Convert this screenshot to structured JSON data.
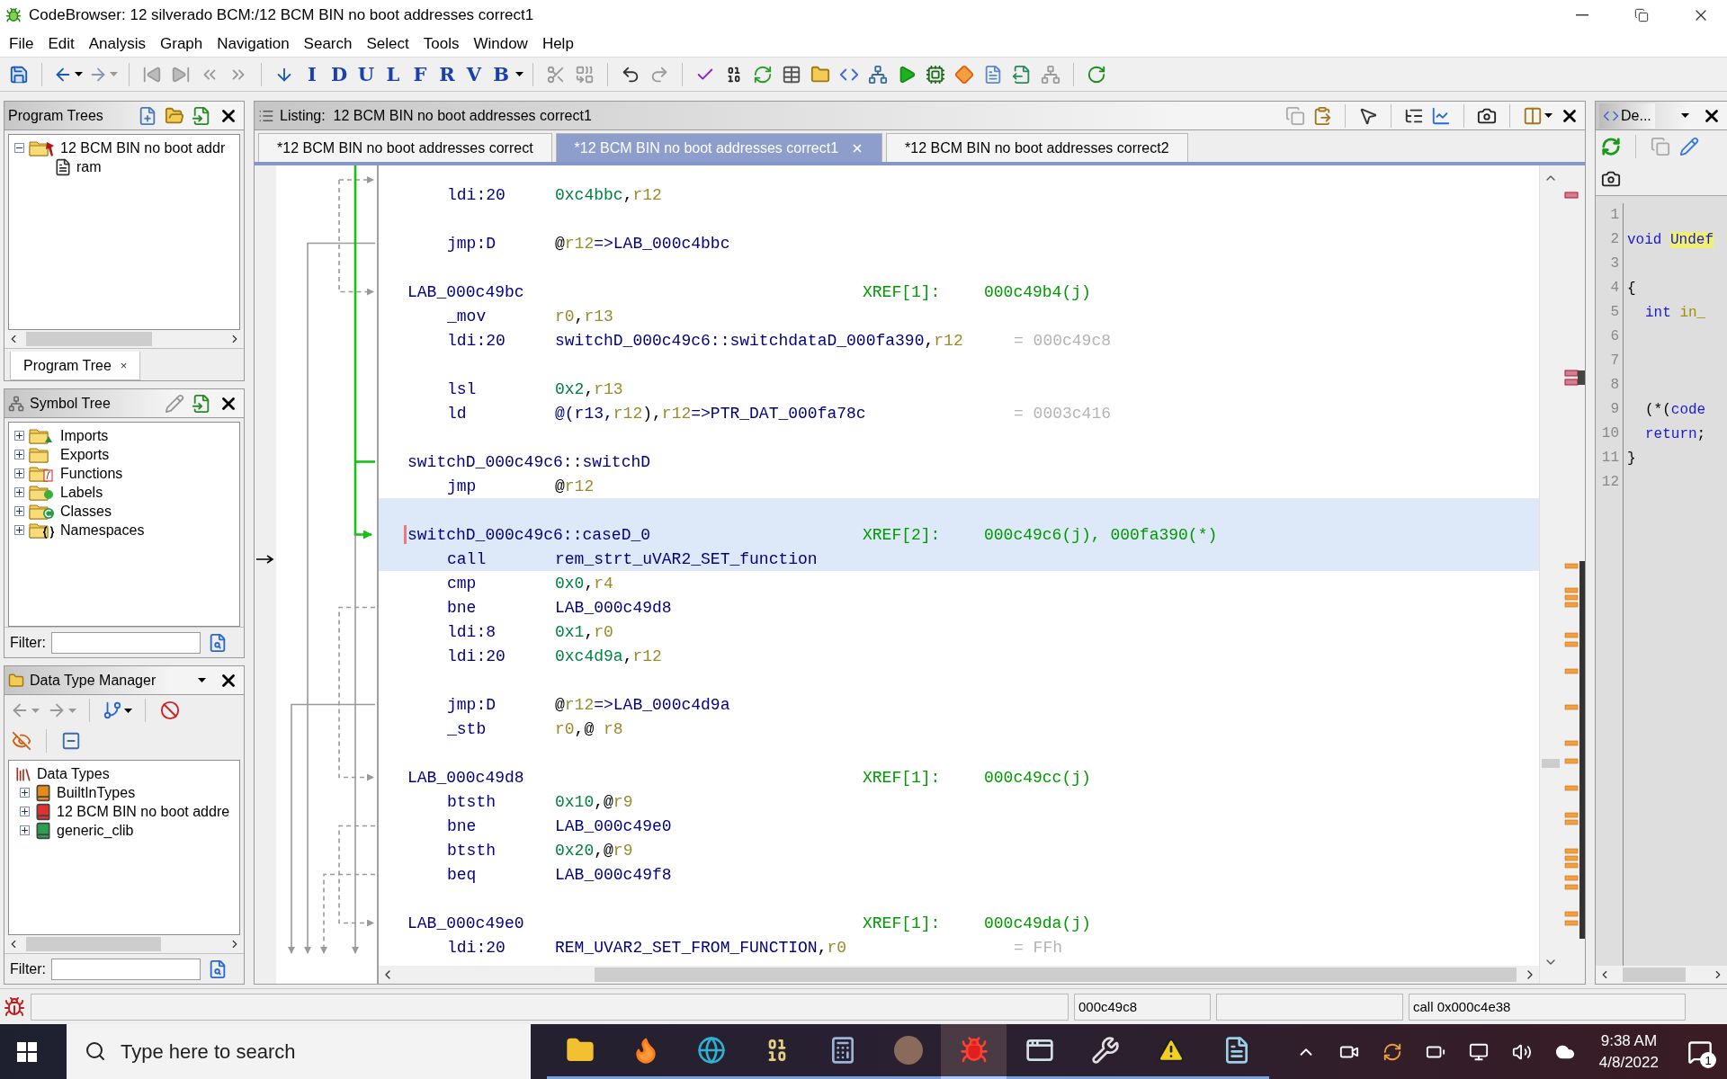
{
  "window": {
    "title": "CodeBrowser: 12 silverado BCM:/12 BCM BIN no boot addresses correct1"
  },
  "menu": [
    "File",
    "Edit",
    "Analysis",
    "Graph",
    "Navigation",
    "Search",
    "Select",
    "Tools",
    "Window",
    "Help"
  ],
  "toolbar": {
    "letter_buttons": [
      "I",
      "D",
      "U",
      "L",
      "F",
      "R",
      "V",
      "B"
    ]
  },
  "program_trees": {
    "title": "Program Trees",
    "tree": [
      {
        "label": "12 BCM BIN no boot addr",
        "expanded": true,
        "children": [
          {
            "label": "ram"
          }
        ]
      }
    ],
    "bottom_tab": {
      "label": "Program Tree",
      "close": "×"
    }
  },
  "symbol_tree": {
    "title": "Symbol Tree",
    "items": [
      {
        "label": "Imports",
        "kind": "imports",
        "expanded": false
      },
      {
        "label": "Exports",
        "kind": "exports",
        "expanded": false
      },
      {
        "label": "Functions",
        "kind": "functions",
        "expanded": false
      },
      {
        "label": "Labels",
        "kind": "labels",
        "expanded": false
      },
      {
        "label": "Classes",
        "kind": "classes",
        "expanded": false
      },
      {
        "label": "Namespaces",
        "kind": "namespaces",
        "expanded": false
      }
    ],
    "filter_label": "Filter:"
  },
  "data_type_manager": {
    "title": "Data Type Manager",
    "root": {
      "label": "Data Types",
      "children": [
        {
          "label": "BuiltInTypes",
          "kind": "builtin",
          "expanded": false
        },
        {
          "label": "12 BCM BIN no boot addre",
          "kind": "program",
          "expanded": false
        },
        {
          "label": "generic_clib",
          "kind": "archive",
          "expanded": false
        }
      ]
    },
    "filter_label": "Filter:"
  },
  "listing": {
    "title": "Listing:  12 BCM BIN no boot addresses correct1",
    "tabs": [
      {
        "label": "*12 BCM BIN no boot addresses correct",
        "selected": false
      },
      {
        "label": "*12 BCM BIN no boot addresses correct1",
        "selected": true
      },
      {
        "label": "*12 BCM BIN no boot addresses correct2",
        "selected": false
      }
    ],
    "rows": [
      {
        "kind": "instr",
        "mnemonic": "ldi:20",
        "operands": [
          {
            "text": "0xc4bbc",
            "kind": "num"
          },
          {
            "text": ",",
            "kind": "punct"
          },
          {
            "text": "r12",
            "kind": "reg"
          }
        ],
        "selected": false,
        "cursor": false,
        "current": false
      },
      {
        "kind": "blank",
        "selected": false,
        "cursor": false,
        "current": false
      },
      {
        "kind": "instr",
        "mnemonic": "jmp:D",
        "operands": [
          {
            "text": "@",
            "kind": "punct"
          },
          {
            "text": "r12",
            "kind": "reg"
          },
          {
            "text": "=>LAB_000c4bbc",
            "kind": "sym"
          }
        ],
        "selected": false,
        "cursor": false,
        "current": false
      },
      {
        "kind": "blank",
        "selected": false,
        "cursor": false,
        "current": false
      },
      {
        "kind": "label",
        "label": "LAB_000c49bc",
        "xref": "XREF[1]:",
        "refs": "000c49b4(j)",
        "selected": false,
        "cursor": false,
        "current": false
      },
      {
        "kind": "instr",
        "mnemonic": "_mov",
        "operands": [
          {
            "text": "r0",
            "kind": "reg"
          },
          {
            "text": ",",
            "kind": "punct"
          },
          {
            "text": "r13",
            "kind": "reg"
          }
        ],
        "selected": false,
        "cursor": false,
        "current": false
      },
      {
        "kind": "instr",
        "mnemonic": "ldi:20",
        "operands": [
          {
            "text": "switchD_000c49c6::switchdataD_000fa390",
            "kind": "sym"
          },
          {
            "text": ",",
            "kind": "punct"
          },
          {
            "text": "r12",
            "kind": "reg"
          }
        ],
        "comment": "= 000c49c8",
        "selected": false,
        "cursor": false,
        "current": false
      },
      {
        "kind": "blank",
        "selected": false,
        "cursor": false,
        "current": false
      },
      {
        "kind": "instr",
        "mnemonic": "lsl",
        "operands": [
          {
            "text": "0x2",
            "kind": "num"
          },
          {
            "text": ",",
            "kind": "punct"
          },
          {
            "text": "r13",
            "kind": "reg"
          }
        ],
        "selected": false,
        "cursor": false,
        "current": false
      },
      {
        "kind": "instr",
        "mnemonic": "ld",
        "operands": [
          {
            "text": "@(r13,",
            "kind": "sym"
          },
          {
            "text": "r12",
            "kind": "reg"
          },
          {
            "text": "),",
            "kind": "punct"
          },
          {
            "text": "r12",
            "kind": "reg"
          },
          {
            "text": "=>PTR_DAT_000fa78c",
            "kind": "sym"
          }
        ],
        "comment": "= 0003c416",
        "selected": false,
        "cursor": false,
        "current": false
      },
      {
        "kind": "blank",
        "selected": false,
        "cursor": false,
        "current": false
      },
      {
        "kind": "label",
        "label": "switchD_000c49c6::switchD",
        "selected": false,
        "cursor": false,
        "current": false
      },
      {
        "kind": "instr",
        "mnemonic": "jmp",
        "operands": [
          {
            "text": "@",
            "kind": "punct"
          },
          {
            "text": "r12",
            "kind": "reg"
          }
        ],
        "selected": false,
        "cursor": false,
        "current": false
      },
      {
        "kind": "blank",
        "selected": true,
        "cursor": false,
        "current": false
      },
      {
        "kind": "label",
        "label": "switchD_000c49c6::caseD_0",
        "xref": "XREF[2]:",
        "refs": "000c49c6(j), 000fa390(*)",
        "selected": true,
        "cursor": true,
        "current": false
      },
      {
        "kind": "instr",
        "mnemonic": "call",
        "operands": [
          {
            "text": "rem_strt_uVAR2_SET_function",
            "kind": "sym"
          }
        ],
        "selected": true,
        "cursor": false,
        "current": true
      },
      {
        "kind": "instr",
        "mnemonic": "cmp",
        "operands": [
          {
            "text": "0x0",
            "kind": "num"
          },
          {
            "text": ",",
            "kind": "punct"
          },
          {
            "text": "r4",
            "kind": "reg"
          }
        ],
        "selected": false,
        "cursor": false,
        "current": false
      },
      {
        "kind": "instr",
        "mnemonic": "bne",
        "operands": [
          {
            "text": "LAB_000c49d8",
            "kind": "sym"
          }
        ],
        "selected": false,
        "cursor": false,
        "current": false
      },
      {
        "kind": "instr",
        "mnemonic": "ldi:8",
        "operands": [
          {
            "text": "0x1",
            "kind": "num"
          },
          {
            "text": ",",
            "kind": "punct"
          },
          {
            "text": "r0",
            "kind": "reg"
          }
        ],
        "selected": false,
        "cursor": false,
        "current": false
      },
      {
        "kind": "instr",
        "mnemonic": "ldi:20",
        "operands": [
          {
            "text": "0xc4d9a",
            "kind": "num"
          },
          {
            "text": ",",
            "kind": "punct"
          },
          {
            "text": "r12",
            "kind": "reg"
          }
        ],
        "selected": false,
        "cursor": false,
        "current": false
      },
      {
        "kind": "blank",
        "selected": false,
        "cursor": false,
        "current": false
      },
      {
        "kind": "instr",
        "mnemonic": "jmp:D",
        "operands": [
          {
            "text": "@",
            "kind": "punct"
          },
          {
            "text": "r12",
            "kind": "reg"
          },
          {
            "text": "=>LAB_000c4d9a",
            "kind": "sym"
          }
        ],
        "selected": false,
        "cursor": false,
        "current": false
      },
      {
        "kind": "instr",
        "mnemonic": "_stb",
        "operands": [
          {
            "text": "r0",
            "kind": "reg"
          },
          {
            "text": ",@ ",
            "kind": "punct"
          },
          {
            "text": "r8",
            "kind": "reg"
          }
        ],
        "selected": false,
        "cursor": false,
        "current": false
      },
      {
        "kind": "blank",
        "selected": false,
        "cursor": false,
        "current": false
      },
      {
        "kind": "label",
        "label": "LAB_000c49d8",
        "xref": "XREF[1]:",
        "refs": "000c49cc(j)",
        "selected": false,
        "cursor": false,
        "current": false
      },
      {
        "kind": "instr",
        "mnemonic": "btsth",
        "operands": [
          {
            "text": "0x10",
            "kind": "num"
          },
          {
            "text": ",@",
            "kind": "punct"
          },
          {
            "text": "r9",
            "kind": "reg"
          }
        ],
        "selected": false,
        "cursor": false,
        "current": false
      },
      {
        "kind": "instr",
        "mnemonic": "bne",
        "operands": [
          {
            "text": "LAB_000c49e0",
            "kind": "sym"
          }
        ],
        "selected": false,
        "cursor": false,
        "current": false
      },
      {
        "kind": "instr",
        "mnemonic": "btsth",
        "operands": [
          {
            "text": "0x20",
            "kind": "num"
          },
          {
            "text": ",@",
            "kind": "punct"
          },
          {
            "text": "r9",
            "kind": "reg"
          }
        ],
        "selected": false,
        "cursor": false,
        "current": false
      },
      {
        "kind": "instr",
        "mnemonic": "beq",
        "operands": [
          {
            "text": "LAB_000c49f8",
            "kind": "sym"
          }
        ],
        "selected": false,
        "cursor": false,
        "current": false
      },
      {
        "kind": "blank",
        "selected": false,
        "cursor": false,
        "current": false
      },
      {
        "kind": "label",
        "label": "LAB_000c49e0",
        "xref": "XREF[1]:",
        "refs": "000c49da(j)",
        "selected": false,
        "cursor": false,
        "current": false
      },
      {
        "kind": "instr",
        "mnemonic": "ldi:20",
        "operands": [
          {
            "text": "REM_UVAR2_SET_FROM_FUNCTION",
            "kind": "sym"
          },
          {
            "text": ",",
            "kind": "punct"
          },
          {
            "text": "r0",
            "kind": "reg"
          }
        ],
        "comment": "= FFh",
        "selected": false,
        "cursor": false,
        "current": false
      }
    ]
  },
  "decompiler": {
    "title": "De...",
    "lines": [
      {
        "number": "1"
      },
      {
        "number": "2",
        "indented": false,
        "tokens": [
          {
            "text": "void ",
            "kind": "keyword"
          },
          {
            "text": "Undef",
            "kind": "highlight"
          }
        ]
      },
      {
        "number": "3"
      },
      {
        "number": "4",
        "indented": false,
        "tokens": [
          {
            "text": "{",
            "kind": "punct"
          }
        ]
      },
      {
        "number": "5",
        "indented": true,
        "tokens": [
          {
            "text": "int ",
            "kind": "keyword"
          },
          {
            "text": "in_",
            "kind": "variable"
          }
        ]
      },
      {
        "number": "6"
      },
      {
        "number": "7"
      },
      {
        "number": "8"
      },
      {
        "number": "9",
        "indented": true,
        "tokens": [
          {
            "text": "(*(",
            "kind": "punct"
          },
          {
            "text": "code",
            "kind": "keyword"
          }
        ]
      },
      {
        "number": "10",
        "indented": true,
        "tokens": [
          {
            "text": "return",
            "kind": "keyword"
          },
          {
            "text": ";",
            "kind": "punct"
          }
        ]
      },
      {
        "number": "11",
        "indented": false,
        "tokens": [
          {
            "text": "}",
            "kind": "punct"
          }
        ]
      },
      {
        "number": "12"
      }
    ]
  },
  "status_bar": {
    "address": "000c49c8",
    "instruction": "call 0x000c4e38"
  },
  "taskbar": {
    "search_placeholder": "Type here to search",
    "apps": [
      {
        "kind": "explorer",
        "selected": false
      },
      {
        "kind": "firefox",
        "selected": false
      },
      {
        "kind": "edge",
        "selected": false
      },
      {
        "kind": "hex",
        "selected": false
      },
      {
        "kind": "calculator",
        "selected": false
      },
      {
        "kind": "portrait",
        "selected": false
      },
      {
        "kind": "ghidra",
        "selected": true
      },
      {
        "kind": "window",
        "selected": false
      },
      {
        "kind": "wrench",
        "selected": false
      },
      {
        "kind": "warning",
        "selected": false
      },
      {
        "kind": "notepad",
        "selected": false
      }
    ],
    "time": "9:38 AM",
    "date": "4/8/2022",
    "notification_count": "1"
  }
}
